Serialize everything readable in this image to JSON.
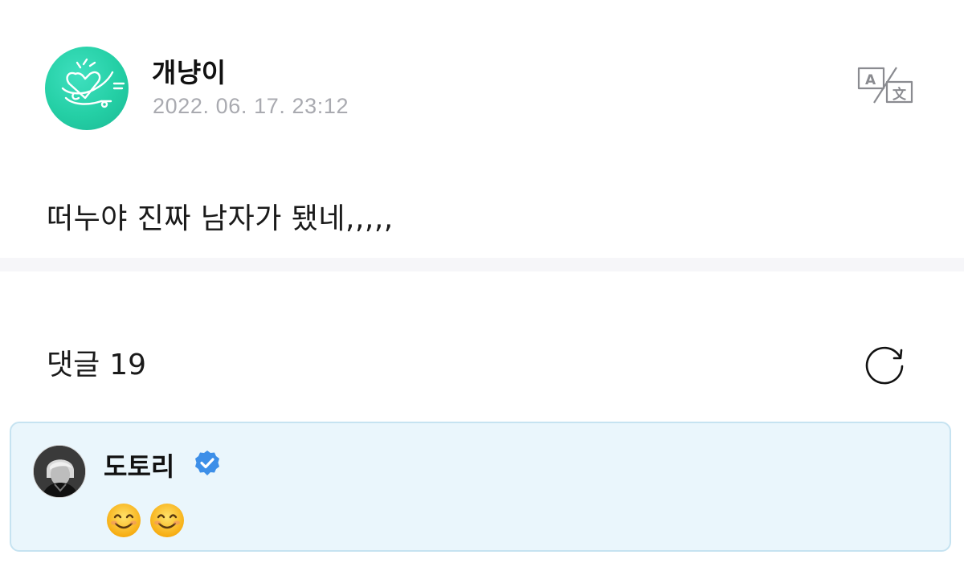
{
  "post": {
    "author": "개냥이",
    "date": "2022. 06. 17. 23:12",
    "body": "떠누야 진짜 남자가 됐네,,,,,",
    "avatar_icon": "heart-logo-icon",
    "translate_icon": "translate-icon"
  },
  "comments": {
    "label": "댓글",
    "count": "19",
    "refresh_icon": "refresh-icon",
    "items": [
      {
        "author": "도토리",
        "verified_icon": "verified-badge-icon",
        "text_emojis": [
          "smiling-face-icon",
          "smiling-face-icon"
        ]
      }
    ]
  },
  "colors": {
    "avatar_green": "#24cfa5",
    "date_gray": "#a9aab0",
    "divider": "#f6f6f9",
    "comment_bg": "#eaf6fc",
    "comment_border": "#c6e3f1",
    "verified_blue": "#3d8fe8"
  }
}
